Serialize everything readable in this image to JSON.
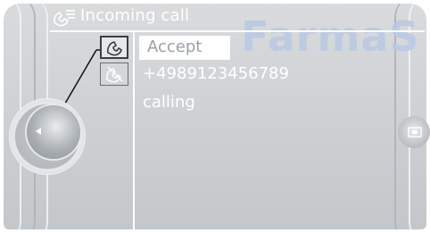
{
  "header": {
    "title": "Incoming call",
    "icon": "phone-list-icon"
  },
  "watermark": "FarmaS",
  "call": {
    "accept_label": "Accept",
    "accept_icon": "phone-accept-icon",
    "reject_icon": "phone-reject-icon",
    "number": "+4989123456789",
    "status": "calling"
  },
  "controller": {
    "knob_icon": "controller-knob-icon",
    "arrow_icon": "left-arrow-icon"
  },
  "right_tab": {
    "icon": "card-tab-icon"
  },
  "colors": {
    "background": "#cdd0d3",
    "text": "#ffffff",
    "highlight": "#ffffff",
    "watermark": "#b9c9e4"
  }
}
